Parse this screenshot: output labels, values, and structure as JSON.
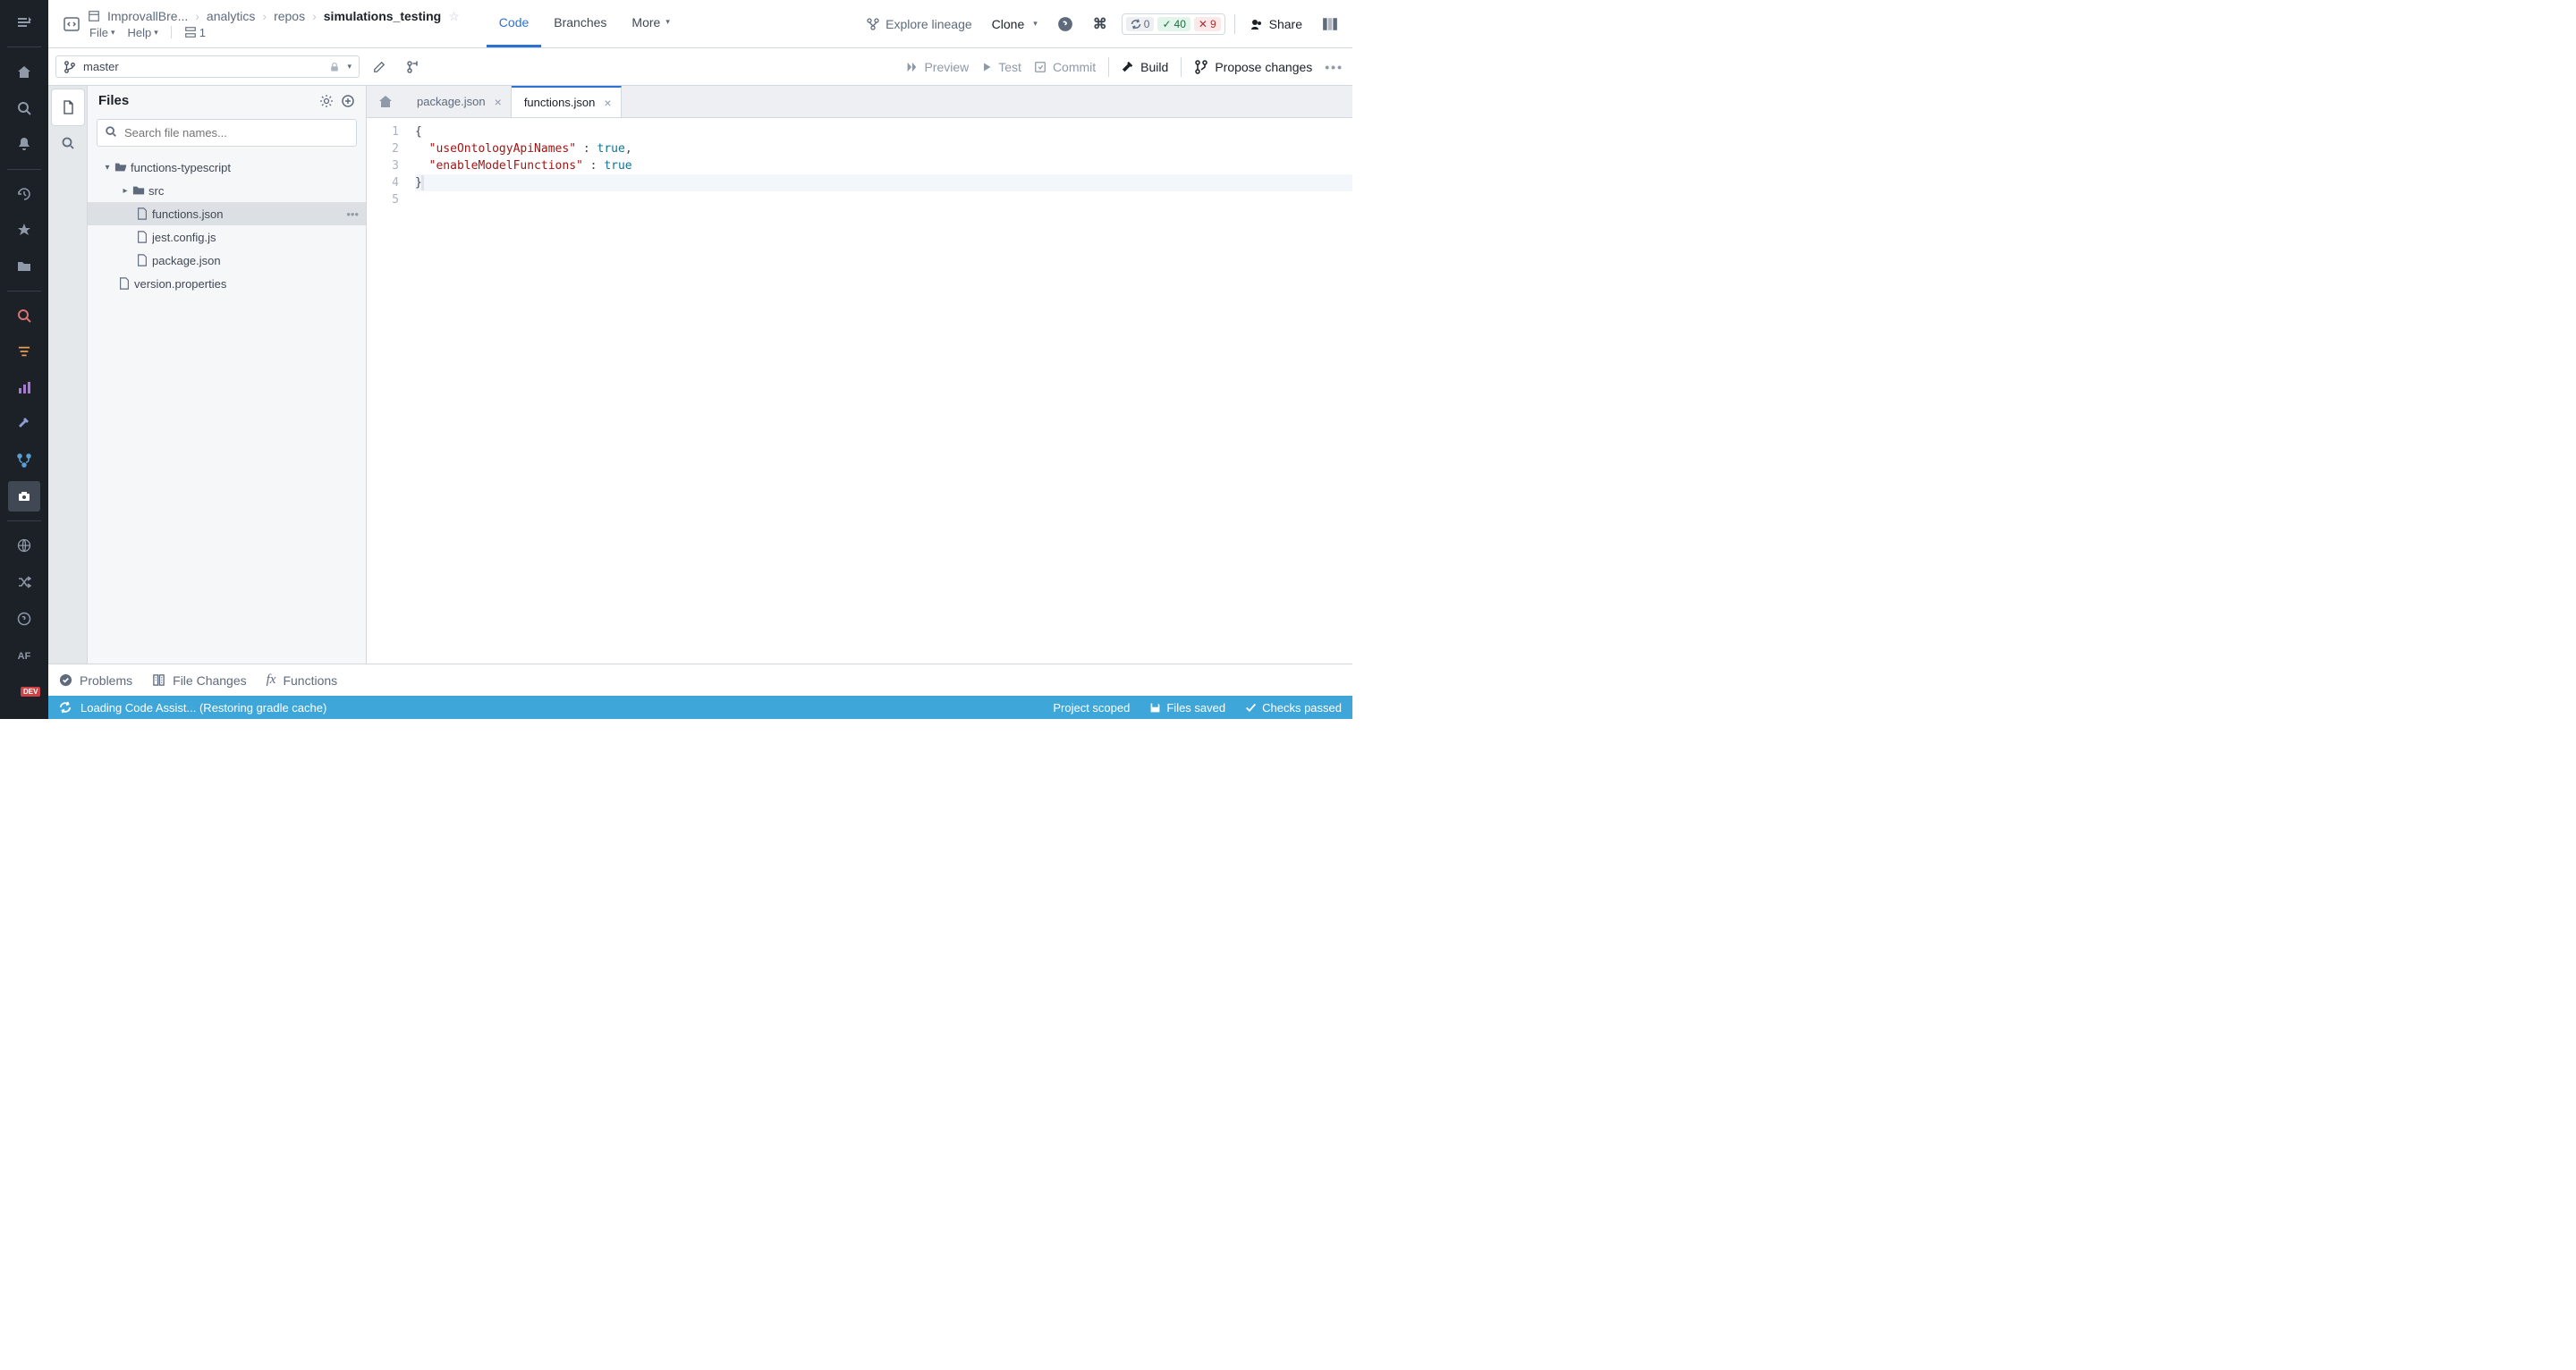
{
  "breadcrumb": {
    "root": "ImprovallBre...",
    "parts": [
      "analytics",
      "repos"
    ],
    "current": "simulations_testing"
  },
  "menubar": {
    "file": "File",
    "help": "Help",
    "workers": "1"
  },
  "headerTabs": {
    "code": "Code",
    "branches": "Branches",
    "more": "More"
  },
  "headerRight": {
    "lineage": "Explore lineage",
    "clone": "Clone",
    "share": "Share",
    "pills": {
      "sync": "0",
      "ok": "40",
      "err": "9"
    }
  },
  "toolbar": {
    "branch": "master",
    "preview": "Preview",
    "test": "Test",
    "commit": "Commit",
    "build": "Build",
    "propose": "Propose changes"
  },
  "filesPanel": {
    "title": "Files",
    "searchPlaceholder": "Search file names..."
  },
  "tree": {
    "root": "functions-typescript",
    "src": "src",
    "files": [
      "functions.json",
      "jest.config.js",
      "package.json"
    ],
    "version": "version.properties"
  },
  "editorTabs": [
    {
      "name": "package.json",
      "active": false
    },
    {
      "name": "functions.json",
      "active": true
    }
  ],
  "code": {
    "lines": [
      "1",
      "2",
      "3",
      "4",
      "5"
    ],
    "key1": "\"useOntologyApiNames\"",
    "key2": "\"enableModelFunctions\"",
    "true": "true"
  },
  "bottomTabs": {
    "problems": "Problems",
    "fileChanges": "File Changes",
    "functions": "Functions"
  },
  "statusBar": {
    "loading": "Loading Code Assist... (Restoring gradle cache)",
    "scope": "Project scoped",
    "saved": "Files saved",
    "checks": "Checks passed"
  },
  "devBadge": "DEV",
  "afLabel": "AF"
}
